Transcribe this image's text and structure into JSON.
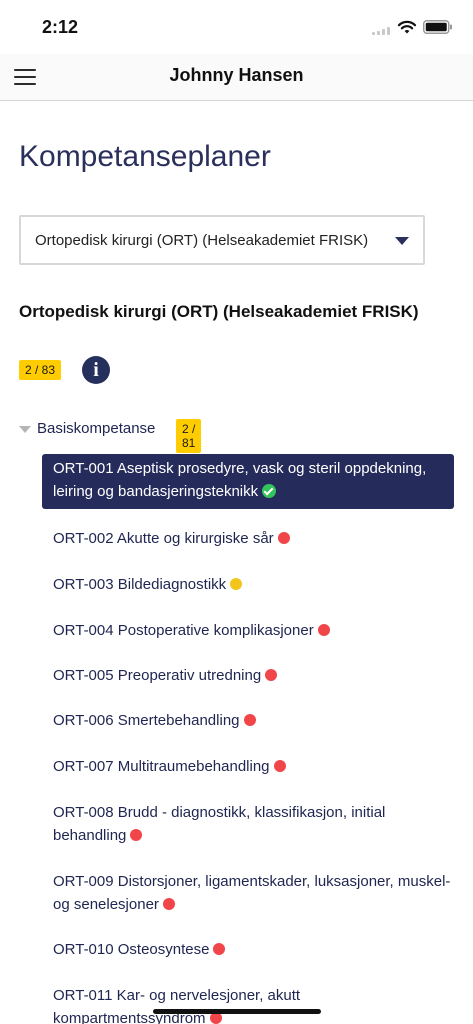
{
  "status_bar": {
    "time": "2:12"
  },
  "nav": {
    "title": "Johnny Hansen",
    "menu_icon": "hamburger-menu-icon"
  },
  "page": {
    "title": "Kompetanseplaner"
  },
  "plan_select": {
    "value": "Ortopedisk kirurgi (ORT) (Helseakademiet FRISK)"
  },
  "plan": {
    "title": "Ortopedisk kirurgi (ORT) (Helseakademiet FRISK)",
    "progress": "2 / 83",
    "info_icon": "info-icon"
  },
  "section": {
    "label": "Basiskompetanse",
    "progress": "2 / 81",
    "expanded": true
  },
  "colors": {
    "primary": "#252c5b",
    "badge": "#ffcc00",
    "status_red": "#f0464a",
    "status_yellow": "#f3c51b",
    "status_green": "#35c35b"
  },
  "items": [
    {
      "label": "ORT-001 Aseptisk prosedyre, vask og steril oppdekning, leiring og bandasjeringsteknikk",
      "status": "green",
      "selected": true
    },
    {
      "label": "ORT-002 Akutte og kirurgiske sår",
      "status": "red"
    },
    {
      "label": "ORT-003 Bildediagnostikk",
      "status": "yellow"
    },
    {
      "label": "ORT-004 Postoperative komplikasjoner",
      "status": "red"
    },
    {
      "label": "ORT-005 Preoperativ utredning",
      "status": "red"
    },
    {
      "label": "ORT-006 Smertebehandling",
      "status": "red"
    },
    {
      "label": "ORT-007 Multitraumebehandling",
      "status": "red"
    },
    {
      "label": "ORT-008 Brudd - diagnostikk, klassifikasjon, initial behandling",
      "status": "red"
    },
    {
      "label": "ORT-009 Distorsjoner, ligamentskader, luksasjoner, muskel- og senelesjoner",
      "status": "red"
    },
    {
      "label": "ORT-010 Osteosyntese",
      "status": "red"
    },
    {
      "label": "ORT-011 Kar- og nervelesjoner, akutt kompartmentssyndrom",
      "status": "red"
    }
  ]
}
